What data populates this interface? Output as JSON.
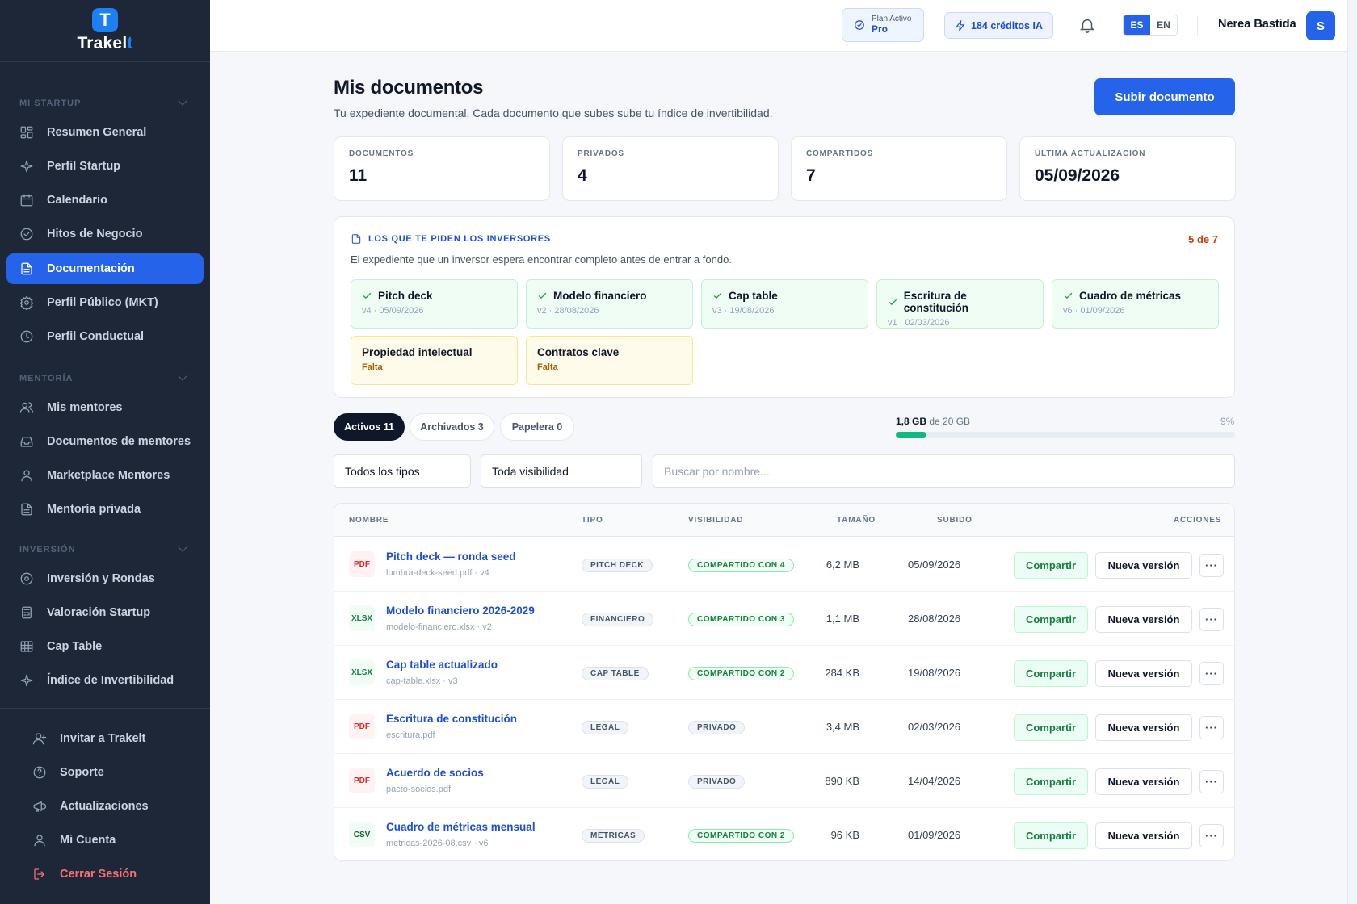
{
  "brand": {
    "name_main": "Trakel",
    "name_accent": "t",
    "logo_letter": "T"
  },
  "sidebar": {
    "sections": [
      {
        "title": "MI STARTUP",
        "items": [
          {
            "label": "Resumen General",
            "icon": "grid-icon"
          },
          {
            "label": "Perfil Startup",
            "icon": "sparkle-icon"
          },
          {
            "label": "Calendario",
            "icon": "calendar-icon"
          },
          {
            "label": "Hitos de Negocio",
            "icon": "check-circle-icon"
          },
          {
            "label": "Documentación",
            "icon": "document-icon",
            "active": true
          },
          {
            "label": "Perfil Público (MKT)",
            "icon": "gear-icon"
          },
          {
            "label": "Perfil Conductual",
            "icon": "clock-icon"
          }
        ]
      },
      {
        "title": "MENTORÍA",
        "items": [
          {
            "label": "Mis mentores",
            "icon": "users-icon"
          },
          {
            "label": "Documentos de mentores",
            "icon": "inbox-icon"
          },
          {
            "label": "Marketplace Mentores",
            "icon": "user-icon"
          },
          {
            "label": "Mentoría privada",
            "icon": "document-icon"
          }
        ]
      },
      {
        "title": "INVERSIÓN",
        "items": [
          {
            "label": "Inversión y Rondas",
            "icon": "target-icon"
          },
          {
            "label": "Valoración Startup",
            "icon": "calculator-icon"
          },
          {
            "label": "Cap Table",
            "icon": "table-icon"
          },
          {
            "label": "Índice de Invertibilidad",
            "icon": "sparkle-icon"
          }
        ]
      }
    ],
    "bottom": [
      {
        "label": "Invitar a Trakelt",
        "icon": "user-plus-icon"
      },
      {
        "label": "Soporte",
        "icon": "help-circle-icon"
      },
      {
        "label": "Actualizaciones",
        "icon": "megaphone-icon"
      },
      {
        "label": "Mi Cuenta",
        "icon": "user-icon"
      },
      {
        "label": "Cerrar Sesión",
        "icon": "logout-icon"
      }
    ]
  },
  "topbar": {
    "plan_label": "Plan Activo",
    "plan_value": "Pro",
    "credits": "184 créditos IA",
    "lang_es": "ES",
    "lang_en": "EN",
    "user_name": "Nerea Bastida",
    "avatar_initial": "S"
  },
  "page": {
    "title": "Mis documentos",
    "subtitle": "Tu expediente documental. Cada documento que subes sube tu índice de invertibilidad.",
    "upload_button": "Subir documento"
  },
  "stats": [
    {
      "label": "DOCUMENTOS",
      "value": "11"
    },
    {
      "label": "PRIVADOS",
      "value": "4"
    },
    {
      "label": "COMPARTIDOS",
      "value": "7"
    },
    {
      "label": "ÚLTIMA ACTUALIZACIÓN",
      "value": "05/09/2026"
    }
  ],
  "investors": {
    "title": "LOS QUE TE PIDEN LOS INVERSORES",
    "count": "5 de 7",
    "subtitle": "El expediente que un inversor espera encontrar completo antes de entrar a fondo.",
    "docs": [
      {
        "name": "Pitch deck",
        "meta": "v4 · 05/09/2026",
        "status": "ok"
      },
      {
        "name": "Modelo financiero",
        "meta": "v2 · 28/08/2026",
        "status": "ok"
      },
      {
        "name": "Cap table",
        "meta": "v3 · 19/08/2026",
        "status": "ok"
      },
      {
        "name": "Escritura de constitución",
        "meta": "v1 · 02/03/2026",
        "status": "ok"
      },
      {
        "name": "Cuadro de métricas",
        "meta": "v6 · 01/09/2026",
        "status": "ok"
      },
      {
        "name": "Propiedad intelectual",
        "meta": "Falta",
        "status": "missing"
      },
      {
        "name": "Contratos clave",
        "meta": "Falta",
        "status": "missing"
      }
    ]
  },
  "tabs": [
    {
      "label": "Activos 11",
      "active": true
    },
    {
      "label": "Archivados 3"
    },
    {
      "label": "Papelera 0"
    }
  ],
  "storage": {
    "used": "1,8 GB",
    "of_text": "de 20 GB",
    "percent_text": "9%",
    "fraction": 0.09
  },
  "filters": {
    "type": "Todos los tipos",
    "visibility": "Toda visibilidad",
    "search_placeholder": "Buscar por nombre..."
  },
  "table": {
    "headers": {
      "name": "NOMBRE",
      "type": "TIPO",
      "visibility": "VISIBILIDAD",
      "size": "TAMAÑO",
      "uploaded": "SUBIDO",
      "actions": "ACCIONES"
    },
    "share_label": "Compartir",
    "version_label": "Nueva versión",
    "more_label": "···",
    "rows": [
      {
        "ext": "PDF",
        "name": "Pitch deck — ronda seed",
        "file": "lumbra-deck-seed.pdf · v4",
        "type": "PITCH DECK",
        "visibility": "COMPARTIDO CON 4",
        "shared": true,
        "size": "6,2 MB",
        "date": "05/09/2026"
      },
      {
        "ext": "XLSX",
        "name": "Modelo financiero 2026-2029",
        "file": "modelo-financiero.xlsx · v2",
        "type": "FINANCIERO",
        "visibility": "COMPARTIDO CON 3",
        "shared": true,
        "size": "1,1 MB",
        "date": "28/08/2026"
      },
      {
        "ext": "XLSX",
        "name": "Cap table actualizado",
        "file": "cap-table.xlsx · v3",
        "type": "CAP TABLE",
        "visibility": "COMPARTIDO CON 2",
        "shared": true,
        "size": "284 KB",
        "date": "19/08/2026"
      },
      {
        "ext": "PDF",
        "name": "Escritura de constitución",
        "file": "escritura.pdf",
        "type": "LEGAL",
        "visibility": "PRIVADO",
        "shared": false,
        "size": "3,4 MB",
        "date": "02/03/2026"
      },
      {
        "ext": "PDF",
        "name": "Acuerdo de socios",
        "file": "pacto-socios.pdf",
        "type": "LEGAL",
        "visibility": "PRIVADO",
        "shared": false,
        "size": "890 KB",
        "date": "14/04/2026"
      },
      {
        "ext": "CSV",
        "name": "Cuadro de métricas mensual",
        "file": "metricas-2026-08.csv · v6",
        "type": "MÉTRICAS",
        "visibility": "COMPARTIDO CON 2",
        "shared": true,
        "size": "96 KB",
        "date": "01/09/2026"
      }
    ]
  }
}
